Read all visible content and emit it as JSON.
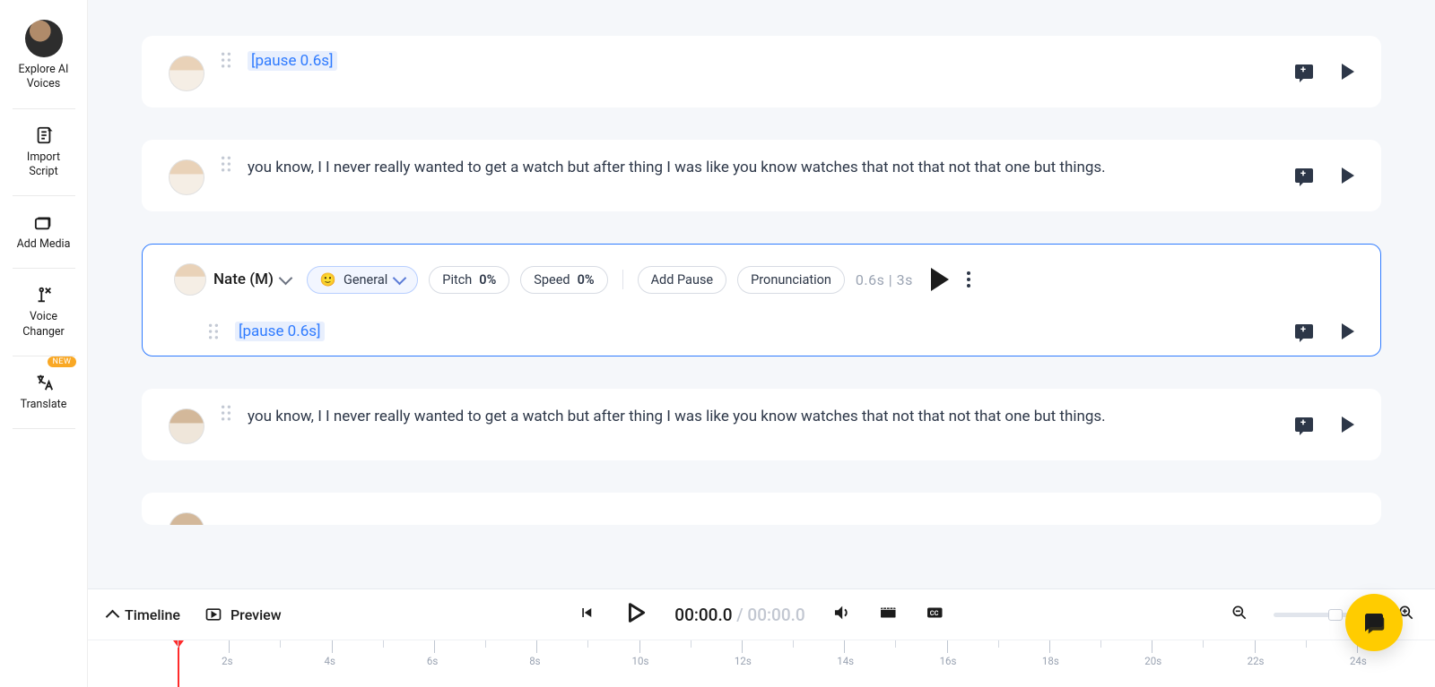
{
  "sidebar": {
    "items": [
      {
        "label": "Explore AI\nVoices",
        "icon": "avatar"
      },
      {
        "label": "Import\nScript",
        "icon": "import"
      },
      {
        "label": "Add Media",
        "icon": "media"
      },
      {
        "label": "Voice\nChanger",
        "icon": "voicechanger"
      },
      {
        "label": "Translate",
        "icon": "translate",
        "badge": "NEW"
      }
    ]
  },
  "blocks": [
    {
      "type": "pause",
      "text": "[pause 0.6s]"
    },
    {
      "type": "line",
      "text": "you know, I I never really wanted to get a watch but after thing I was like you know watches that not that not that one but things."
    },
    {
      "type": "selected",
      "voice": "Nate (M)",
      "style": "General",
      "pitch_label": "Pitch",
      "pitch_value": "0%",
      "speed_label": "Speed",
      "speed_value": "0%",
      "add_pause": "Add Pause",
      "pronunciation": "Pronunciation",
      "duration": "0.6s | 3s",
      "inner_pause": "[pause 0.6s]"
    },
    {
      "type": "line",
      "text": "you know, I I never really wanted to get a watch but after thing I was like you know watches that not that not that one but things."
    }
  ],
  "player": {
    "timeline": "Timeline",
    "preview": "Preview",
    "time_current": "00:00.0",
    "time_sep": " / ",
    "time_total": "00:00.0",
    "ticks": [
      "2s",
      "4s",
      "6s",
      "8s",
      "10s",
      "12s",
      "14s",
      "16s",
      "18s",
      "20s",
      "22s",
      "24s"
    ]
  }
}
